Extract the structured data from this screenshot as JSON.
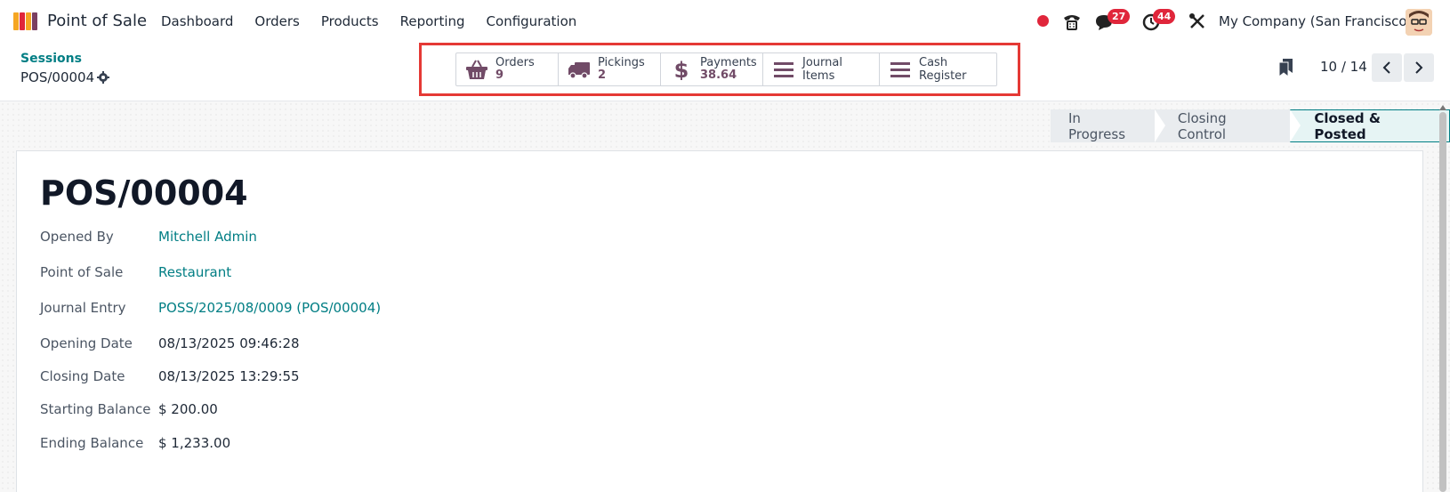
{
  "navbar": {
    "app_name": "Point of Sale",
    "menu": [
      "Dashboard",
      "Orders",
      "Products",
      "Reporting",
      "Configuration"
    ],
    "messages_count": "27",
    "activities_count": "44",
    "company": "My Company (San Francisco)"
  },
  "control": {
    "breadcrumb": "Sessions",
    "record": "POS/00004",
    "smart_buttons": {
      "orders": {
        "label": "Orders",
        "value": "9"
      },
      "pickings": {
        "label": "Pickings",
        "value": "2"
      },
      "payments": {
        "label": "Payments",
        "value": "38.64"
      },
      "journal_items": {
        "label": "Journal Items"
      },
      "cash_register": {
        "label": "Cash Register"
      }
    },
    "pager": "10 / 14"
  },
  "statusbar": {
    "stages": [
      "In Progress",
      "Closing Control",
      "Closed & Posted"
    ],
    "active": "Closed & Posted"
  },
  "form": {
    "title": "POS/00004",
    "fields": {
      "opened_by": {
        "label": "Opened By",
        "value": "Mitchell Admin"
      },
      "point_of_sale": {
        "label": "Point of Sale",
        "value": "Restaurant"
      },
      "journal_entry": {
        "label": "Journal Entry",
        "value": "POSS/2025/08/0009 (POS/00004)"
      },
      "opening_date": {
        "label": "Opening Date",
        "value": "08/13/2025 09:46:28"
      },
      "closing_date": {
        "label": "Closing Date",
        "value": "08/13/2025 13:29:55"
      },
      "starting_balance": {
        "label": "Starting Balance",
        "value": "$ 200.00"
      },
      "ending_balance": {
        "label": "Ending Balance",
        "value": "$ 1,233.00"
      }
    }
  },
  "colors": {
    "accent": "#017e84",
    "brand": "#714b67",
    "badge": "#e0263b",
    "highlight": "#e53935"
  }
}
